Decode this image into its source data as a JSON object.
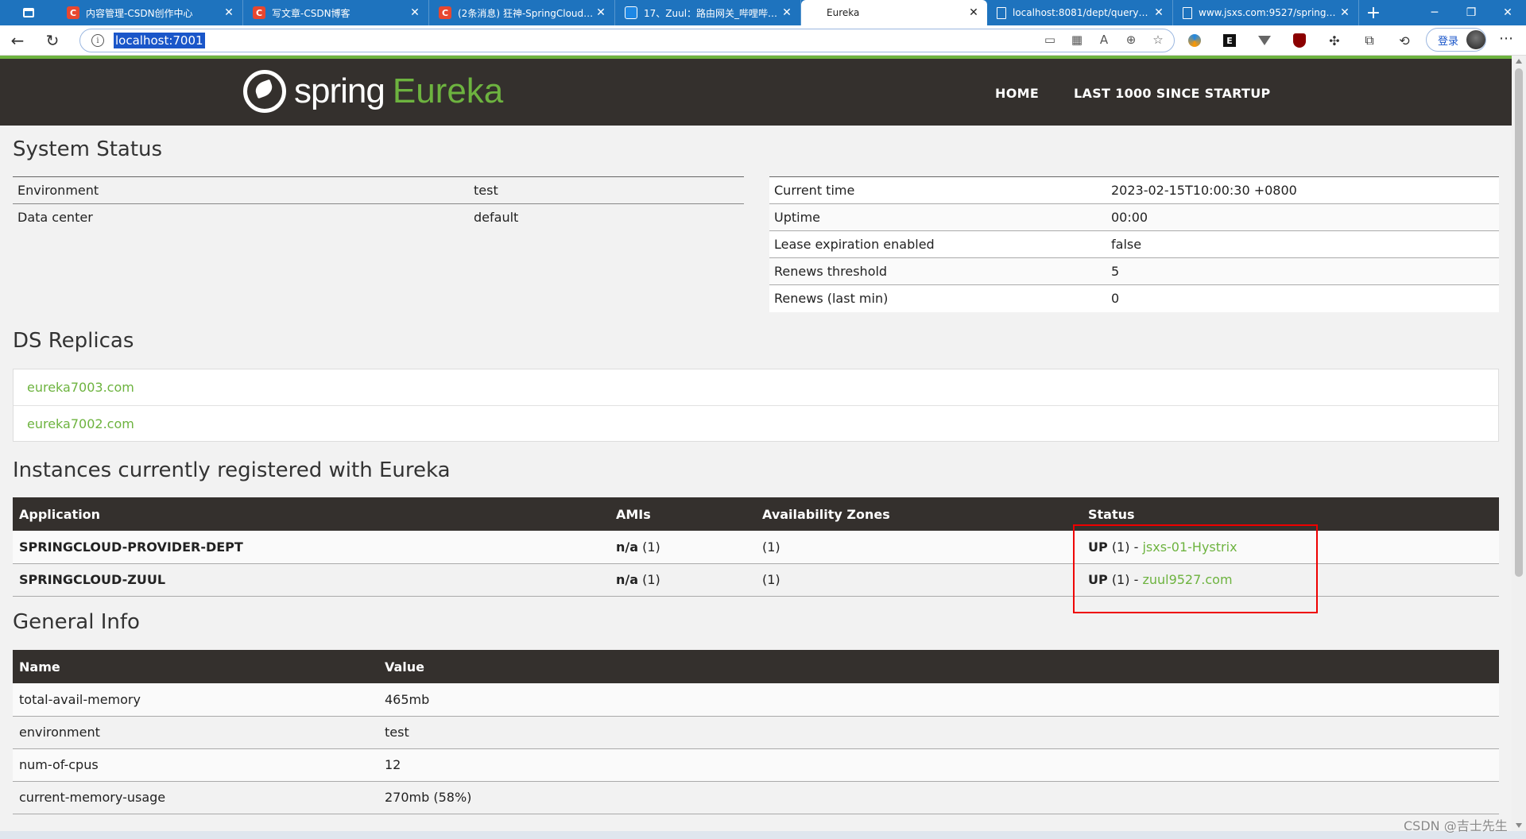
{
  "browser": {
    "tabs": [
      {
        "title": "内容管理-CSDN创作中心",
        "favicon": "csdn-icon",
        "active": false
      },
      {
        "title": "写文章-CSDN博客",
        "favicon": "csdn-icon",
        "active": false
      },
      {
        "title": "(2条消息) 狂神-SpringCloud笔记",
        "favicon": "csdn-icon",
        "active": false
      },
      {
        "title": "17、Zuul：路由网关_哔哩哔哩_bilibili",
        "favicon": "bilibili-icon",
        "active": false
      },
      {
        "title": "Eureka",
        "favicon": "page-icon",
        "active": true
      },
      {
        "title": "localhost:8081/dept/queryById",
        "favicon": "page-icon",
        "active": false
      },
      {
        "title": "www.jsxs.com:9527/springcloud",
        "favicon": "page-icon",
        "active": false
      }
    ],
    "address": "localhost:7001",
    "login_label": "登录"
  },
  "header": {
    "brand_spring": "spring",
    "brand_eureka": "Eureka",
    "nav": [
      "HOME",
      "LAST 1000 SINCE STARTUP"
    ]
  },
  "system_status": {
    "title": "System Status",
    "left": [
      {
        "name": "Environment",
        "value": "test"
      },
      {
        "name": "Data center",
        "value": "default"
      }
    ],
    "right": [
      {
        "name": "Current time",
        "value": "2023-02-15T10:00:30 +0800"
      },
      {
        "name": "Uptime",
        "value": "00:00"
      },
      {
        "name": "Lease expiration enabled",
        "value": "false"
      },
      {
        "name": "Renews threshold",
        "value": "5"
      },
      {
        "name": "Renews (last min)",
        "value": "0"
      }
    ]
  },
  "ds_replicas": {
    "title": "DS Replicas",
    "items": [
      "eureka7003.com",
      "eureka7002.com"
    ]
  },
  "instances": {
    "title": "Instances currently registered with Eureka",
    "columns": [
      "Application",
      "AMIs",
      "Availability Zones",
      "Status"
    ],
    "rows": [
      {
        "application": "SPRINGCLOUD-PROVIDER-DEPT",
        "amis_label": "n/a",
        "amis_count": "(1)",
        "zones": "(1)",
        "status_label": "UP",
        "status_count": "(1) -",
        "instance": "jsxs-01-Hystrix"
      },
      {
        "application": "SPRINGCLOUD-ZUUL",
        "amis_label": "n/a",
        "amis_count": "(1)",
        "zones": "(1)",
        "status_label": "UP",
        "status_count": "(1) -",
        "instance": "zuul9527.com"
      }
    ]
  },
  "general_info": {
    "title": "General Info",
    "columns": [
      "Name",
      "Value"
    ],
    "rows": [
      {
        "name": "total-avail-memory",
        "value": "465mb"
      },
      {
        "name": "environment",
        "value": "test"
      },
      {
        "name": "num-of-cpus",
        "value": "12"
      },
      {
        "name": "current-memory-usage",
        "value": "270mb (58%)"
      }
    ]
  },
  "watermark": "CSDN @吉士先生",
  "colors": {
    "spring_green": "#6db33f",
    "header_dark": "#34302d",
    "tab_blue": "#1e73be",
    "highlight_red": "#ee0000"
  }
}
